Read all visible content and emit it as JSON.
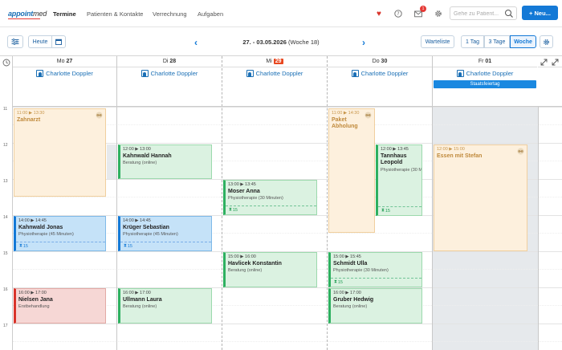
{
  "app": {
    "logo_a": "appoint",
    "logo_b": "med"
  },
  "nav": {
    "items": [
      "Termine",
      "Patienten & Kontakte",
      "Verrechnung",
      "Aufgaben"
    ],
    "notification_count": "1",
    "search_placeholder": "Gehe zu Patient...",
    "new_button": "+ Neu..."
  },
  "toolbar": {
    "today": "Heute",
    "date_range": "27. - 03.05.2026",
    "week_label": "(Woche 18)",
    "waitlist": "Warteliste",
    "views": [
      "1 Tag",
      "3 Tage",
      "Woche"
    ],
    "active_view": "Woche"
  },
  "days": [
    {
      "name": "Mo",
      "num": "27",
      "person": "Charlotte Doppler"
    },
    {
      "name": "Di",
      "num": "28",
      "person": "Charlotte Doppler"
    },
    {
      "name": "Mi",
      "num": "29",
      "person": "Charlotte Doppler",
      "today": true
    },
    {
      "name": "Do",
      "num": "30",
      "person": "Charlotte Doppler"
    },
    {
      "name": "Fr",
      "num": "01",
      "person": "Charlotte Doppler"
    }
  ],
  "holiday": "Staatsfeiertag",
  "hours": [
    "11",
    "12",
    "13",
    "14",
    "15",
    "16",
    "17"
  ],
  "events": {
    "zahnarzt": {
      "time": "11:00 ▶ 13:30",
      "title": "Zahnarzt"
    },
    "kahnwald_hannah": {
      "time": "12:00 ▶ 13:00",
      "name": "Kahnwald Hannah",
      "desc": "Beratung (online)"
    },
    "kahnwald_jonas": {
      "time": "14:00 ▶ 14:45",
      "name": "Kahnwald Jonas",
      "desc": "Physiotherapie (45 Minuten)",
      "count": "15"
    },
    "nielsen_jana": {
      "time": "16:00 ▶ 17:00",
      "name": "Nielsen Jana",
      "desc": "Erstbehandlung"
    },
    "krueger_sebastian": {
      "time": "14:00 ▶ 14:45",
      "name": "Krüger Sebastian",
      "desc": "Physiotherapie (45 Minuten)",
      "count": "15"
    },
    "ullmann_laura": {
      "time": "16:00 ▶ 17:00",
      "name": "Ullmann Laura",
      "desc": "Beratung (online)"
    },
    "moser_anna": {
      "time": "13:00 ▶ 13:45",
      "name": "Moser Anna",
      "desc": "Physiotherapie (30 Minuten)",
      "count": "15"
    },
    "havlicek_konstantin": {
      "time": "15:00 ▶ 16:00",
      "name": "Havlicek Konstantin",
      "desc": "Beratung (online)"
    },
    "paket_abholung": {
      "time": "11:00 ▶ 14:30",
      "title": "Paket Abholung"
    },
    "tannhaus_leopold": {
      "time": "12:00 ▶ 13:45",
      "name": "Tannhaus Leopold",
      "desc": "Physiotherapie (30 M",
      "count": "15"
    },
    "schmidt_ulla": {
      "time": "15:00 ▶ 15:45",
      "name": "Schmidt Ulla",
      "desc": "Physiotherapie (30 Minuten)",
      "count": "15"
    },
    "gruber_hedwig": {
      "time": "16:00 ▶ 17:00",
      "name": "Gruber Hedwig",
      "desc": "Beratung (online)"
    },
    "essen_stefan": {
      "time": "12:00 ▶ 15:00",
      "title": "Essen mit Stefan"
    }
  },
  "colors": {
    "accent": "#1479d6",
    "green": "#2eb060",
    "red": "#d9342b",
    "private": "#fdf0dd",
    "today": "#e8471f"
  }
}
